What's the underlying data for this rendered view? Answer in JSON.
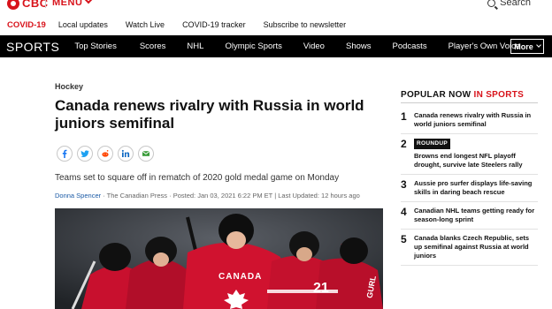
{
  "header": {
    "logo": "CBC",
    "menu_label": "MENU",
    "search_label": "Search"
  },
  "covid_bar": {
    "tag": "COVID-19",
    "links": [
      "Local updates",
      "Watch Live",
      "COVID-19 tracker",
      "Subscribe to newsletter"
    ]
  },
  "nav": {
    "brand": "SPORTS",
    "items": [
      "Top Stories",
      "Scores",
      "NHL",
      "Olympic Sports",
      "Video",
      "Shows",
      "Podcasts",
      "Player's Own Voice"
    ],
    "more_label": "More"
  },
  "article": {
    "section": "Hockey",
    "headline": "Canada renews rivalry with Russia in world juniors semifinal",
    "deck": "Teams set to square off in rematch of 2020 gold medal game on Monday",
    "author": "Donna Spencer",
    "byline_rest": " · The Canadian Press · Posted: Jan 03, 2021 6:22 PM ET | Last Updated: 12 hours ago",
    "share_icons": [
      "facebook-icon",
      "twitter-icon",
      "reddit-icon",
      "linkedin-icon",
      "email-icon"
    ],
    "photo_text": {
      "jersey_word": "CANADA",
      "number": "21",
      "name_bar": "GURL"
    }
  },
  "popular": {
    "title_main": "POPULAR NOW",
    "title_accent": "IN SPORTS",
    "items": [
      {
        "num": "1",
        "badge": "",
        "text": "Canada renews rivalry with Russia in world juniors semifinal"
      },
      {
        "num": "2",
        "badge": "ROUNDUP",
        "text": "Browns end longest NFL playoff drought, survive late Steelers rally"
      },
      {
        "num": "3",
        "badge": "",
        "text": "Aussie pro surfer displays life-saving skills in daring beach rescue"
      },
      {
        "num": "4",
        "badge": "",
        "text": "Canadian NHL teams getting ready for season-long sprint"
      },
      {
        "num": "5",
        "badge": "",
        "text": "Canada blanks Czech Republic, sets up semifinal against Russia at world juniors"
      }
    ]
  },
  "colors": {
    "brand_red": "#d8131b",
    "nav_bg": "#000000",
    "link_blue": "#1a5aa6"
  }
}
